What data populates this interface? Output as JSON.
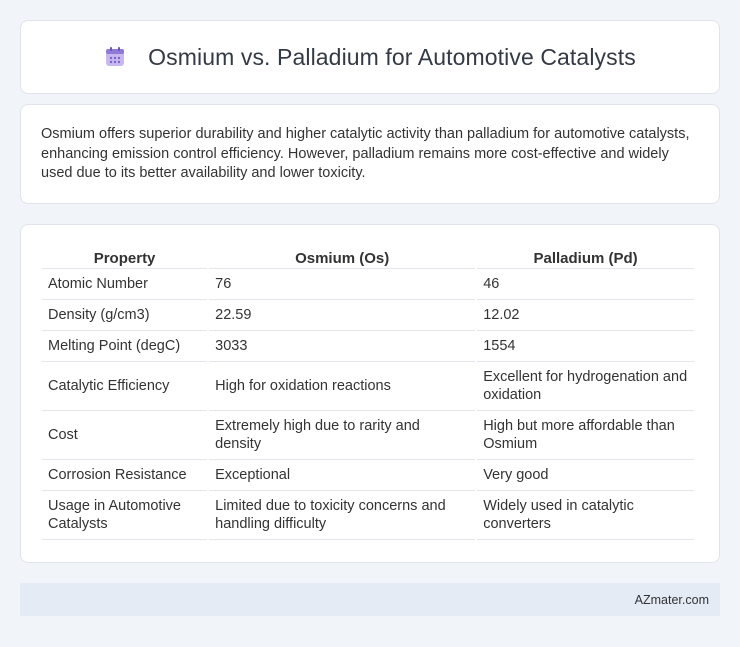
{
  "header": {
    "title": "Osmium vs. Palladium for Automotive Catalysts",
    "icon": "calendar-icon"
  },
  "summary": {
    "text": "Osmium offers superior durability and higher catalytic activity than palladium for automotive catalysts, enhancing emission control efficiency. However, palladium remains more cost-effective and widely used due to its better availability and lower toxicity."
  },
  "table": {
    "headers": [
      "Property",
      "Osmium (Os)",
      "Palladium (Pd)"
    ],
    "rows": [
      [
        "Atomic Number",
        "76",
        "46"
      ],
      [
        "Density (g/cm3)",
        "22.59",
        "12.02"
      ],
      [
        "Melting Point (degC)",
        "3033",
        "1554"
      ],
      [
        "Catalytic Efficiency",
        "High for oxidation reactions",
        "Excellent for hydrogenation and oxidation"
      ],
      [
        "Cost",
        "Extremely high due to rarity and density",
        "High but more affordable than Osmium"
      ],
      [
        "Corrosion Resistance",
        "Exceptional",
        "Very good"
      ],
      [
        "Usage in Automotive Catalysts",
        "Limited due to toxicity concerns and handling difficulty",
        "Widely used in catalytic converters"
      ]
    ]
  },
  "footer": {
    "brand": "AZmater.com"
  }
}
